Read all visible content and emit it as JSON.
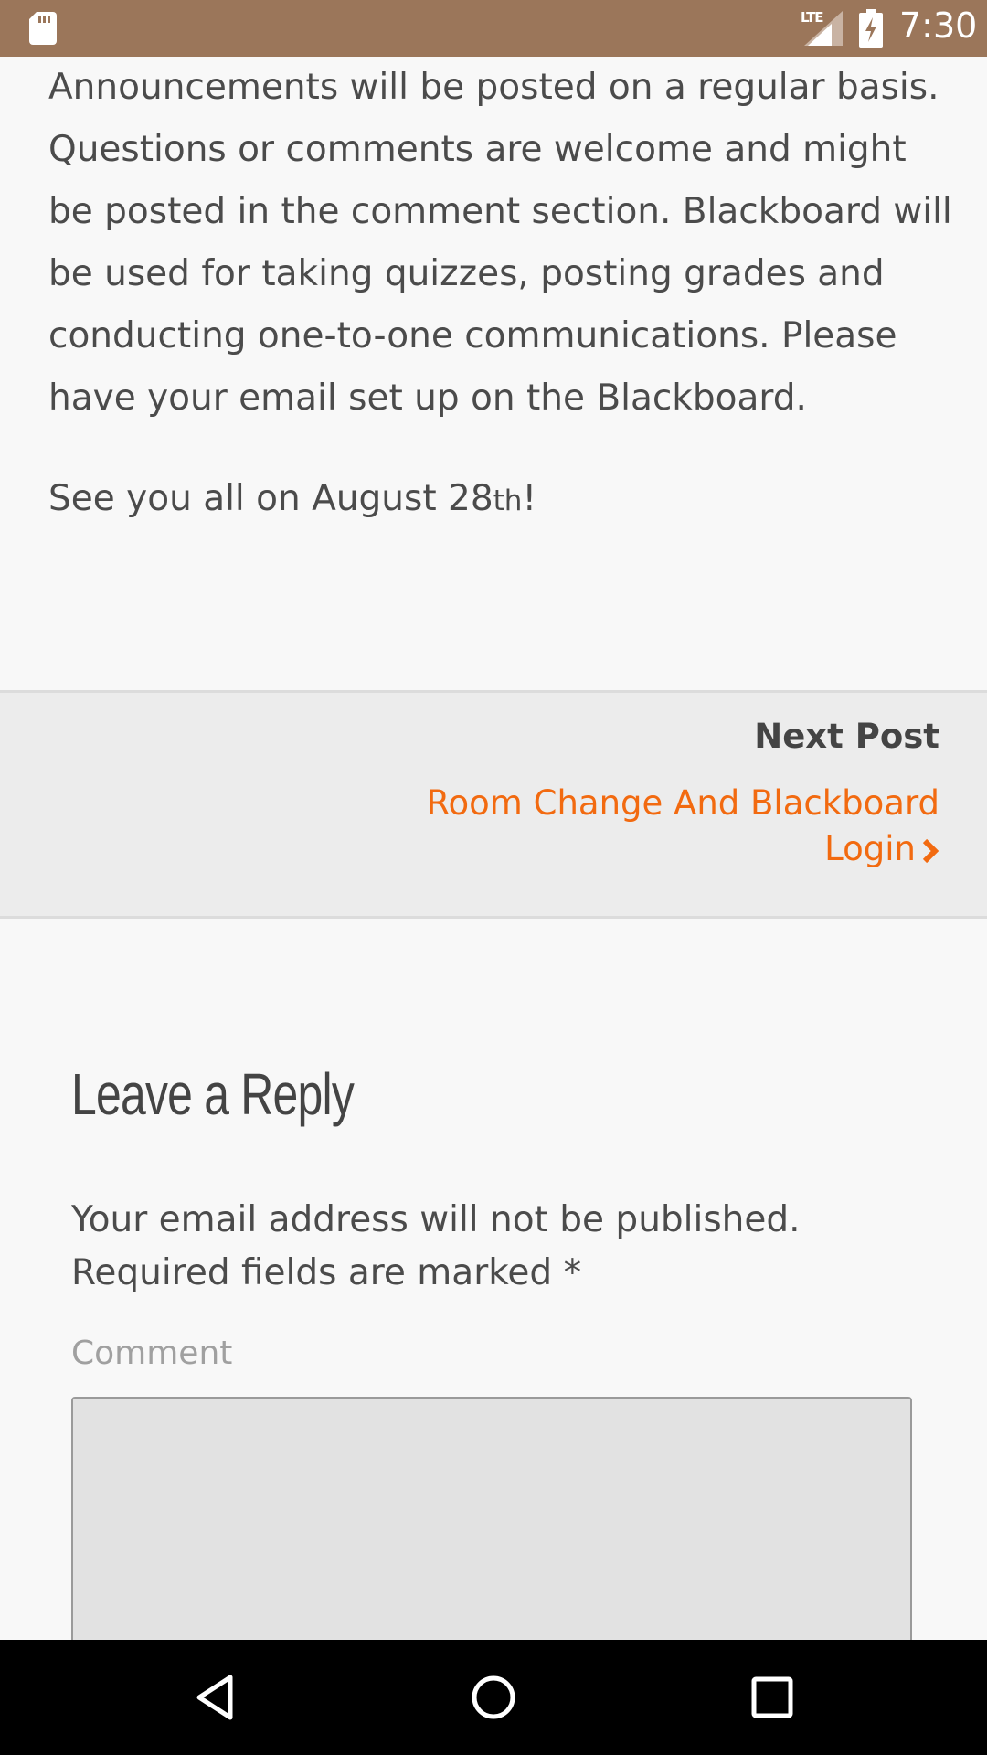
{
  "status_bar": {
    "network_label": "LTE",
    "time": "7:30",
    "icons": [
      "sd-card-icon",
      "signal-icon",
      "battery-charging-icon"
    ]
  },
  "article": {
    "paragraph": "Announcements will be posted on a regular basis. Questions or comments are welcome and might be posted in the comment section. Blackboard will be used for taking quizzes, posting grades and conducting one-to-one communications. Please have your email set up on the Blackboard.",
    "closing_prefix": "See you all on August 28",
    "closing_sup": "th",
    "closing_suffix": "!"
  },
  "post_navigation": {
    "heading": "Next Post",
    "link_text": "Room Change And Blackboard Login",
    "link_color": "#f26a10"
  },
  "reply": {
    "title": "Leave a Reply",
    "note": "Your email address will not be published. Required fields are marked *",
    "comment_label": "Comment",
    "comment_value": ""
  },
  "nav_bar": {
    "buttons": [
      "back-icon",
      "home-icon",
      "recents-icon"
    ]
  },
  "colors": {
    "status_bar": "#9b765a",
    "accent": "#f26a10",
    "background": "#f8f8f8"
  }
}
